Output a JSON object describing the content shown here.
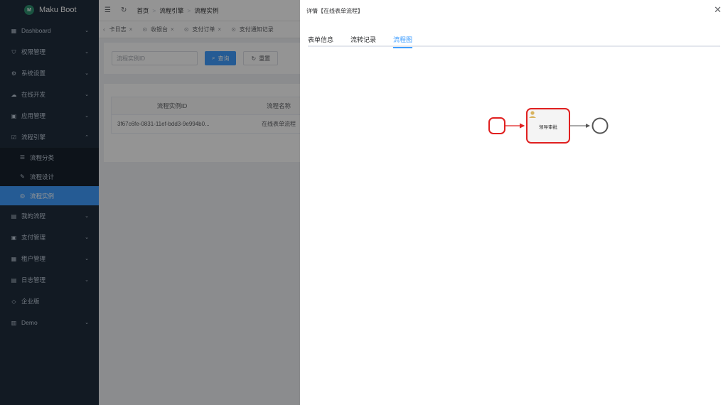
{
  "app": {
    "title": "Maku Boot",
    "logo_text": "M"
  },
  "sidebar": {
    "items": [
      {
        "label": "Dashboard",
        "icon": "dashboard-icon",
        "glyph": "▦",
        "chevron": "⌄"
      },
      {
        "label": "权限管理",
        "icon": "shield-icon",
        "glyph": "⛉",
        "chevron": "⌄"
      },
      {
        "label": "系统设置",
        "icon": "gear-icon",
        "glyph": "⚙",
        "chevron": "⌄"
      },
      {
        "label": "在线开发",
        "icon": "cloud-icon",
        "glyph": "☁",
        "chevron": "⌄"
      },
      {
        "label": "应用管理",
        "icon": "grid-icon",
        "glyph": "▣",
        "chevron": "⌄"
      },
      {
        "label": "流程引擎",
        "icon": "flow-icon",
        "glyph": "☑",
        "chevron": "⌃"
      }
    ],
    "subitems": [
      {
        "label": "流程分类",
        "icon": "list-icon",
        "glyph": "☰"
      },
      {
        "label": "流程设计",
        "icon": "design-icon",
        "glyph": "✎"
      },
      {
        "label": "流程实例",
        "icon": "instance-icon",
        "glyph": "◎",
        "active": true
      }
    ],
    "items_after": [
      {
        "label": "我的流程",
        "icon": "doc-icon",
        "glyph": "▤",
        "chevron": "⌄"
      },
      {
        "label": "支付管理",
        "icon": "pay-icon",
        "glyph": "▣",
        "chevron": "⌄"
      },
      {
        "label": "租户管理",
        "icon": "tenant-icon",
        "glyph": "▦",
        "chevron": "⌄"
      },
      {
        "label": "日志管理",
        "icon": "log-icon",
        "glyph": "▤",
        "chevron": "⌄"
      },
      {
        "label": "企业版",
        "icon": "diamond-icon",
        "glyph": "◇",
        "chevron": ""
      },
      {
        "label": "Demo",
        "icon": "demo-icon",
        "glyph": "▥",
        "chevron": "⌄"
      }
    ]
  },
  "topbar": {
    "menu_glyph": "☰",
    "refresh_glyph": "↻",
    "breadcrumb": [
      "首页",
      "流程引擎",
      "流程实例"
    ],
    "sep": ">"
  },
  "tabs": [
    {
      "label": "卡日志"
    },
    {
      "label": "收银台"
    },
    {
      "label": "支付订单"
    },
    {
      "label": "支付通知记录"
    }
  ],
  "search": {
    "placeholder": "流程实例ID",
    "query_label": "查询",
    "query_glyph": "⌕",
    "reset_label": "重置",
    "reset_glyph": "↻"
  },
  "table": {
    "columns": [
      "流程实例ID",
      "流程名称"
    ],
    "rows": [
      [
        "3f67c6fe-0831-11ef-bdd3-9e994b0...",
        "在线表单流程"
      ]
    ]
  },
  "drawer": {
    "title": "详情【在线表单流程】",
    "close_glyph": "✕",
    "tabs": [
      "表单信息",
      "流转记录",
      "流程图"
    ],
    "active_tab": 2,
    "diagram": {
      "task_label": "领导审批",
      "highlight_color": "#e02020",
      "edge_color": "#555555"
    }
  },
  "colors": {
    "primary": "#409eff",
    "sidebar_bg": "#1f2d3d"
  }
}
